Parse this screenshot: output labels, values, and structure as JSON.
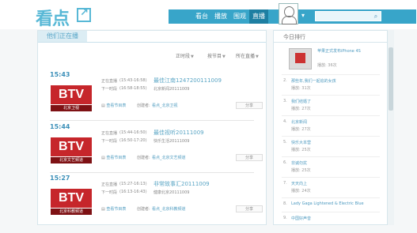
{
  "header": {
    "logo_text": "看点",
    "nav": [
      {
        "label": "看台"
      },
      {
        "label": "播放"
      },
      {
        "label": "围观"
      },
      {
        "label": "直播"
      }
    ],
    "active_nav": "直播",
    "user_menu_icon": "user-menu-icon",
    "search_placeholder": "",
    "search_icon": "search-icon"
  },
  "main": {
    "tab_label": "他们正在播",
    "filters": [
      {
        "label": "正时段",
        "caret": "▼"
      },
      {
        "label": "按节目",
        "caret": "▼"
      },
      {
        "label": "所在直播",
        "caret": "▼"
      }
    ],
    "entries": [
      {
        "time": "15:43",
        "channel_logo": "BTV",
        "channel_sub": "北京卫视",
        "now_label": "正在直播",
        "now_time": "(15:43-16:58)",
        "now_title": "最佳江南1247200111009",
        "next_label": "下一时段",
        "next_time": "(16:58-18:55)",
        "next_title": "北京新闻20111009",
        "actions": "查看节目表",
        "creator_label": "创建者:",
        "creator_name": "看点_北京卫视",
        "share": "分享"
      },
      {
        "time": "15:44",
        "channel_logo": "BTV",
        "channel_sub": "北京文艺频道",
        "now_label": "正在直播",
        "now_time": "(15:44-16:50)",
        "now_title": "最佳视听20111009",
        "next_label": "下一时段",
        "next_time": "(16:50-17:20)",
        "next_title": "快乐生活20111009",
        "actions": "查看节目表",
        "creator_label": "创建者:",
        "creator_name": "看点_北京文艺频道",
        "share": "分享"
      },
      {
        "time": "15:27",
        "channel_logo": "BTV",
        "channel_sub": "北京科教频道",
        "now_label": "正在直播",
        "now_time": "(15:27-16:13)",
        "now_title": "非常故事汇20111009",
        "next_label": "下一时段",
        "next_time": "(16:13-16:43)",
        "next_title": "健康北京20111009",
        "actions": "查看节目表",
        "creator_label": "创建者:",
        "creator_name": "看点_北京科教频道",
        "share": "分享"
      }
    ]
  },
  "sidebar": {
    "title": "今日排行",
    "items": [
      {
        "rank": "1.",
        "title": "苹果正式发布iPhone 4S",
        "sub": "播放: 36次"
      },
      {
        "rank": "2.",
        "title": "那些年,我们一起追的女孩",
        "sub": "播放: 31次"
      },
      {
        "rank": "3.",
        "title": "我们结婚了",
        "sub": "播放: 27次"
      },
      {
        "rank": "4.",
        "title": "北京新闻",
        "sub": "播放: 27次"
      },
      {
        "rank": "5.",
        "title": "快乐大本营",
        "sub": "播放: 25次"
      },
      {
        "rank": "6.",
        "title": "非诚勿扰",
        "sub": "播放: 25次"
      },
      {
        "rank": "7.",
        "title": "天天向上",
        "sub": "播放: 24次"
      },
      {
        "rank": "8.",
        "title": "Lady Gaga Lightened & Electric Blue",
        "sub": ""
      },
      {
        "rank": "9.",
        "title": "中国好声音",
        "sub": ""
      }
    ]
  },
  "colors": {
    "accent": "#38a5c9",
    "nav_active": "#1e7fa2",
    "btv_red": "#c6262b"
  }
}
